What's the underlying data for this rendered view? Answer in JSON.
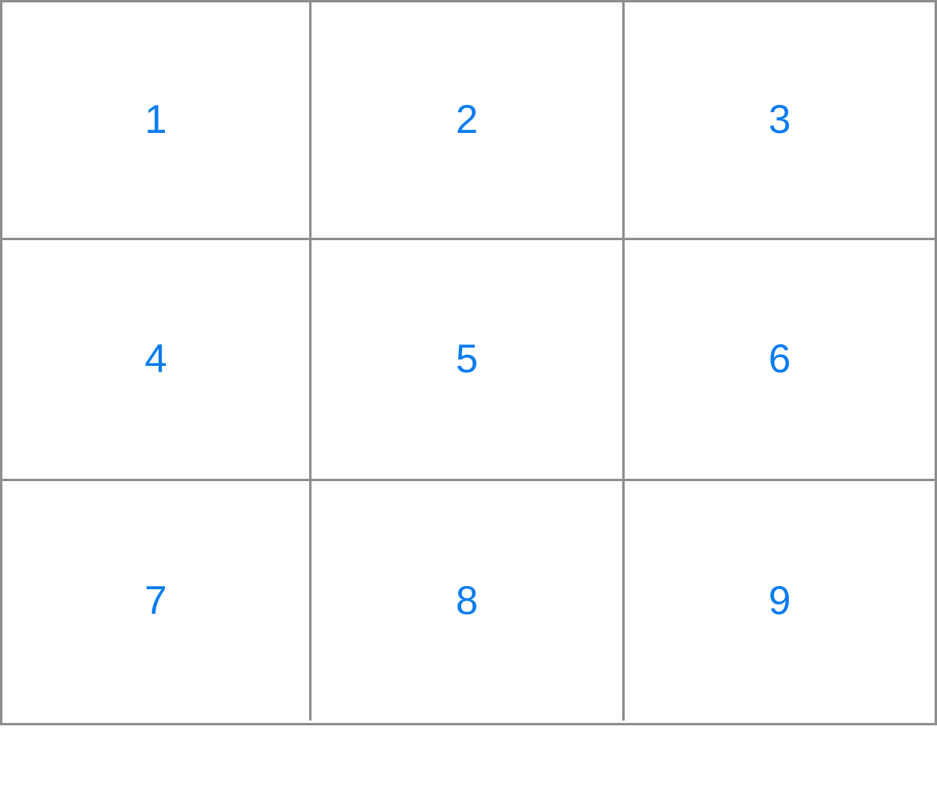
{
  "keypad": {
    "accent_color": "#0a7cf0",
    "border_color": "#8e8e8e",
    "keys": [
      "1",
      "2",
      "3",
      "4",
      "5",
      "6",
      "7",
      "8",
      "9"
    ]
  }
}
